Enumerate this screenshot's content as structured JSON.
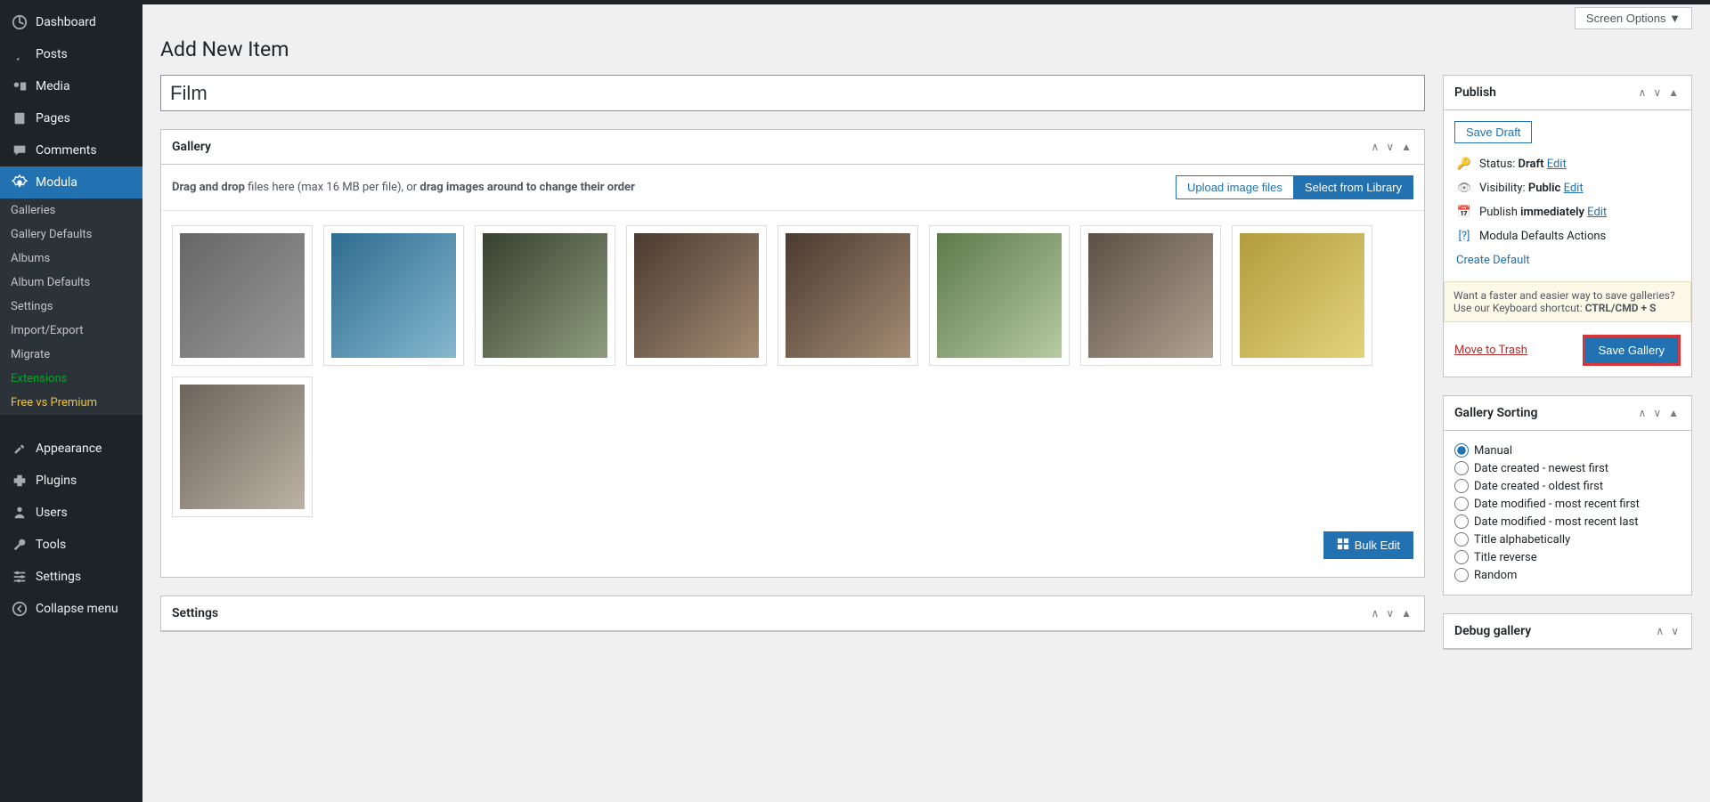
{
  "screen_options": "Screen Options ▼",
  "page_title": "Add New Item",
  "title_value": "Film",
  "sidebar": {
    "items": [
      {
        "label": "Dashboard"
      },
      {
        "label": "Posts"
      },
      {
        "label": "Media"
      },
      {
        "label": "Pages"
      },
      {
        "label": "Comments"
      },
      {
        "label": "Modula"
      }
    ],
    "sub": {
      "galleries": "Galleries",
      "gallery_defaults": "Gallery Defaults",
      "albums": "Albums",
      "album_defaults": "Album Defaults",
      "settings": "Settings",
      "import_export": "Import/Export",
      "migrate": "Migrate",
      "extensions": "Extensions",
      "free_vs_premium": "Free vs Premium"
    },
    "items2": [
      {
        "label": "Appearance"
      },
      {
        "label": "Plugins"
      },
      {
        "label": "Users"
      },
      {
        "label": "Tools"
      },
      {
        "label": "Settings"
      },
      {
        "label": "Collapse menu"
      }
    ]
  },
  "gallery_box": {
    "title": "Gallery",
    "instructions_pre": "Drag and drop",
    "instructions_mid": " files here (max 16 MB per file), or ",
    "instructions_post": "drag images around to change their order",
    "upload_btn": "Upload image files",
    "select_btn": "Select from Library",
    "bulk_edit": "Bulk Edit"
  },
  "thumbs": [
    "bw-park",
    "sea-rocks",
    "doorway",
    "coffee-bar-1",
    "coffee-bar-2",
    "deer-park",
    "guitar-player",
    "yellow-building",
    "city-street"
  ],
  "settings_box": {
    "title": "Settings"
  },
  "publish": {
    "title": "Publish",
    "save_draft": "Save Draft",
    "status_label": "Status: ",
    "status_value": "Draft",
    "visibility_label": "Visibility: ",
    "visibility_value": "Public",
    "publish_label": "Publish ",
    "publish_value": "immediately",
    "edit": "Edit",
    "defaults_actions": "Modula Defaults Actions",
    "create_default": "Create Default",
    "tip_text": "Want a faster and easier way to save galleries? Use our Keyboard shortcut: ",
    "tip_shortcut": "CTRL/CMD + S",
    "trash": "Move to Trash",
    "save": "Save Gallery"
  },
  "sorting": {
    "title": "Gallery Sorting",
    "options": [
      {
        "label": "Manual",
        "checked": true
      },
      {
        "label": "Date created - newest first",
        "checked": false
      },
      {
        "label": "Date created - oldest first",
        "checked": false
      },
      {
        "label": "Date modified - most recent first",
        "checked": false
      },
      {
        "label": "Date modified - most recent last",
        "checked": false
      },
      {
        "label": "Title alphabetically",
        "checked": false
      },
      {
        "label": "Title reverse",
        "checked": false
      },
      {
        "label": "Random",
        "checked": false
      }
    ]
  },
  "debug": {
    "title": "Debug gallery"
  }
}
